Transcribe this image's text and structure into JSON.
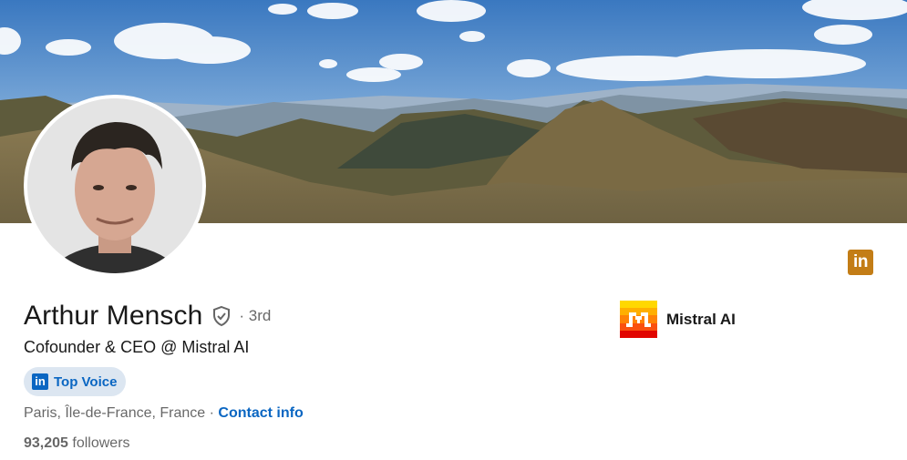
{
  "profile": {
    "name": "Arthur Mensch",
    "degree": "· 3rd",
    "headline": "Cofounder & CEO @ Mistral AI",
    "badge_label": "Top Voice",
    "badge_icon": "linkedin-icon",
    "location": "Paris, Île-de-France, France",
    "separator": " · ",
    "contact_label": "Contact info",
    "followers_count": "93,205",
    "followers_label": "followers"
  },
  "company": {
    "name": "Mistral AI"
  },
  "brand": {
    "linkedin_badge_color": "#c37d16",
    "link_color": "#0a66c2",
    "top_voice_bg": "#dce6f1"
  }
}
